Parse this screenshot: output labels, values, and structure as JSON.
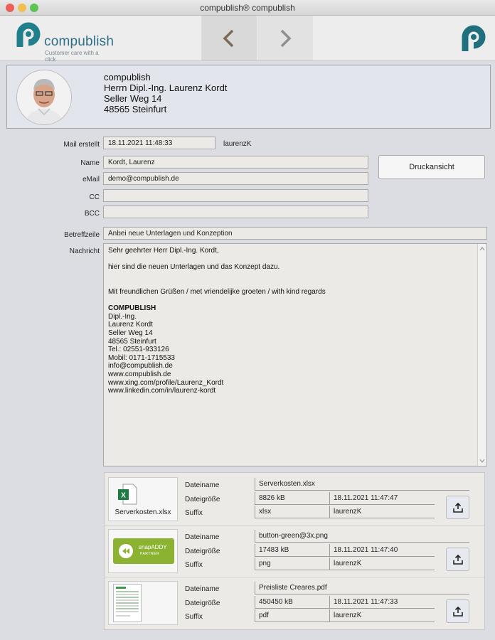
{
  "window": {
    "title": "compublish® compublish"
  },
  "toolbar": {
    "logo_text": "compublish",
    "logo_sub": "Customer care with a click",
    "back_glyph": "‹",
    "forward_glyph": "›"
  },
  "contact": {
    "company": "compublish",
    "salutation": "Herrn Dipl.-Ing. Laurenz Kordt",
    "street": "Seller Weg 14",
    "city": "48565 Steinfurt"
  },
  "form": {
    "created_label": "Mail erstellt",
    "created_value": "18.11.2021 11:48:33",
    "created_by": "laurenzK",
    "name_label": "Name",
    "name_value": "Kordt, Laurenz",
    "email_label": "eMail",
    "email_value": "demo@compublish.de",
    "cc_label": "CC",
    "cc_value": "",
    "bcc_label": "BCC",
    "bcc_value": "",
    "print_label": "Druckansicht",
    "subject_label": "Betreffzeile",
    "subject_value": "Anbei neue Unterlagen und Konzeption",
    "message_label": "Nachricht",
    "message_lines": [
      "Sehr geehrter Herr Dipl.-Ing. Kordt,",
      "",
      "hier sind die neuen Unterlagen und das Konzept dazu.",
      "",
      "",
      "Mit freundlichen Grüßen / met vriendelijke groeten / with kind regards",
      "",
      "COMPUBLISH",
      "Dipl.-Ing.",
      "Laurenz Kordt",
      "Seller Weg 14",
      "48565 Steinfurt",
      "Tel.: 02551-933126",
      "Mobil: 0171-1715533",
      "info@compublish.de",
      "www.compublish.de",
      "www.xing.com/profile/Laurenz_Kordt",
      "www.linkedin.com/in/laurenz-kordt"
    ]
  },
  "attachments_labels": {
    "filename": "Dateiname",
    "filesize": "Dateigröße",
    "suffix": "Suffix"
  },
  "attachments": [
    {
      "thumb_caption": "Serverkosten.xlsx",
      "filename": "Serverkosten.xlsx",
      "size": "8826 kB",
      "date": "18.11.2021 11:47:47",
      "suffix": "xlsx",
      "user": "laurenzK"
    },
    {
      "thumb_caption": "",
      "badge_top": "snapADDY",
      "badge_bottom": "PARTNER",
      "filename": "button-green@3x.png",
      "size": "17483 kB",
      "date": "18.11.2021 11:47:40",
      "suffix": "png",
      "user": "laurenzK"
    },
    {
      "thumb_caption": "",
      "filename": "Preisliste Creares.pdf",
      "size": "450450 kB",
      "date": "18.11.2021 11:47:33",
      "suffix": "pdf",
      "user": "laurenzK"
    }
  ]
}
